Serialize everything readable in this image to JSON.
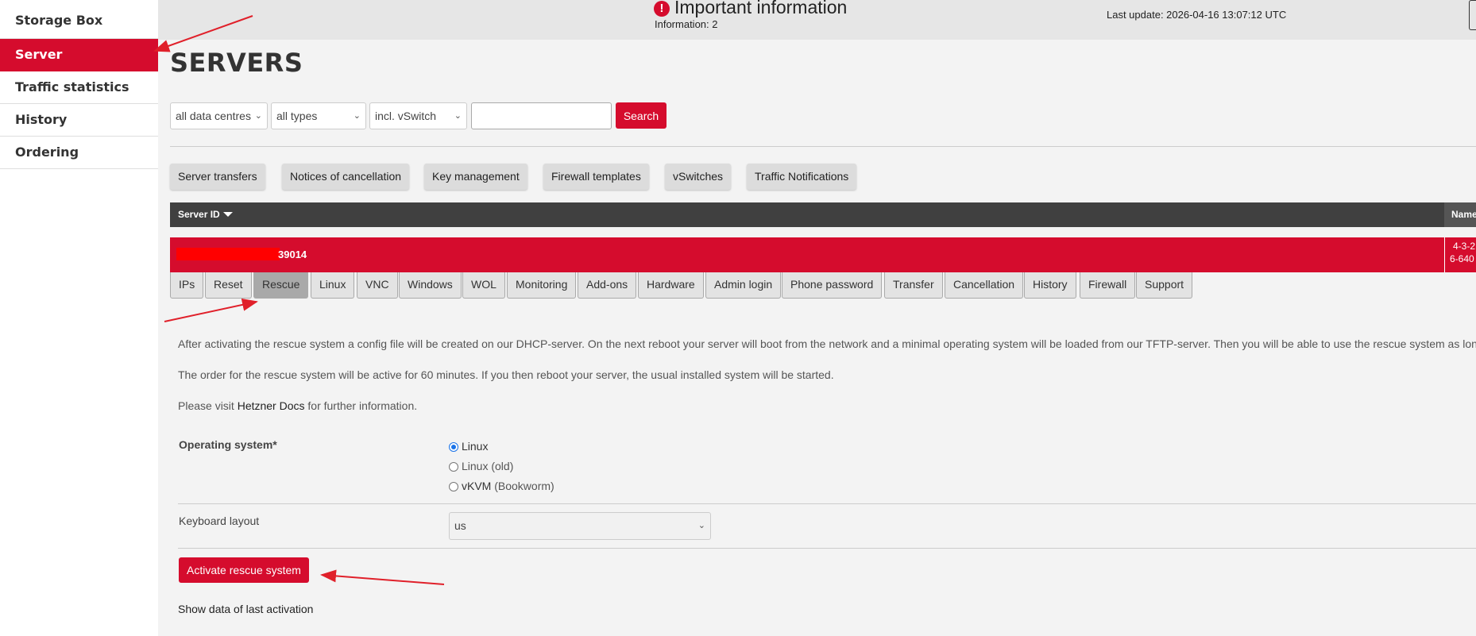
{
  "sidebar": {
    "items": [
      {
        "label": "Storage Box"
      },
      {
        "label": "Server",
        "active": true
      },
      {
        "label": "Traffic statistics"
      },
      {
        "label": "History"
      },
      {
        "label": "Ordering"
      }
    ]
  },
  "header": {
    "info_title": "Important information",
    "info_sub": "Information: 2",
    "last_update": "Last update: 2026-04-16 13:07:12 UTC"
  },
  "page_title": "SERVERS",
  "filters": {
    "data_centre": "all data centres",
    "type": "all types",
    "vswitch": "incl. vSwitch",
    "search_value": "",
    "search_label": "Search"
  },
  "toolbar": [
    "Server transfers",
    "Notices of cancellation",
    "Key management",
    "Firewall templates",
    "vSwitches",
    "Traffic Notifications"
  ],
  "table": {
    "col_server_id": "Server ID",
    "col_name": "Name",
    "server_id_visible": "39014",
    "name_fragment_1": "4-3-2",
    "name_fragment_2": "6-640"
  },
  "tabs": [
    "IPs",
    "Reset",
    "Rescue",
    "Linux",
    "VNC",
    "Windows",
    "WOL",
    "Monitoring",
    "Add-ons",
    "Hardware",
    "Admin login",
    "Phone password",
    "Transfer",
    "Cancellation",
    "History",
    "Firewall",
    "Support"
  ],
  "active_tab": "Rescue",
  "rescue": {
    "p1": "After activating the rescue system a config file will be created on our DHCP-server. On the next reboot your server will boot from the network and a minimal operating system will be loaded from our TFTP-server. Then you will be able to use the rescue system as lon",
    "p2": "The order for the rescue system will be active for 60 minutes. If you then reboot your server, the usual installed system will be started.",
    "p3_prefix": "Please visit ",
    "p3_link": "Hetzner Docs",
    "p3_suffix": " for further information.",
    "os_label": "Operating system*",
    "os_options": [
      {
        "label": "Linux",
        "suffix": "",
        "selected": true
      },
      {
        "label": "Linux (old)",
        "suffix": "",
        "selected": false
      },
      {
        "label": "vKVM",
        "suffix": " (Bookworm)",
        "selected": false
      }
    ],
    "keyboard_label": "Keyboard layout",
    "keyboard_value": "us",
    "activate_label": "Activate rescue system",
    "last_activation_label": "Show data of last activation"
  },
  "colors": {
    "brand_red": "#d50c2d",
    "header_dark": "#404040",
    "annotation_arrow": "#e0202a"
  },
  "icons": {
    "info": "exclamation-circle-icon",
    "sort": "caret-down-icon",
    "select": "chevron-down-icon"
  }
}
